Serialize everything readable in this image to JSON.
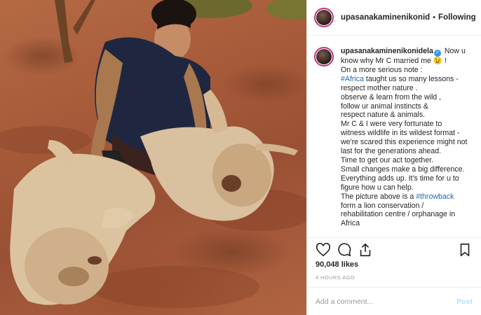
{
  "post": {
    "username": "upasanakaminenikonid",
    "follow_label": "Following",
    "caption_username": "upasanakaminenikonidela",
    "caption_lines": [
      {
        "pre": " Now u",
        "tag": "",
        "post": ""
      },
      {
        "pre": "know why Mr C married me 😉 !",
        "tag": "",
        "post": ""
      },
      {
        "pre": "On a more serious note :",
        "tag": "",
        "post": ""
      },
      {
        "pre": "",
        "tag": "#Africa",
        "post": " taught us so many lessons -"
      },
      {
        "pre": "respect mother nature .",
        "tag": "",
        "post": ""
      },
      {
        "pre": "observe & learn from the wild ,",
        "tag": "",
        "post": ""
      },
      {
        "pre": "follow ur animal instincts &",
        "tag": "",
        "post": ""
      },
      {
        "pre": "respect nature & animals.",
        "tag": "",
        "post": ""
      },
      {
        "pre": "Mr C & I were very fortunate to",
        "tag": "",
        "post": ""
      },
      {
        "pre": "witness wildlife in its wildest format -",
        "tag": "",
        "post": ""
      },
      {
        "pre": "we're scared this experience might not",
        "tag": "",
        "post": ""
      },
      {
        "pre": "last for the generations ahead.",
        "tag": "",
        "post": ""
      },
      {
        "pre": "Time to get our act together.",
        "tag": "",
        "post": ""
      },
      {
        "pre": "Small changes make a big difference.",
        "tag": "",
        "post": ""
      },
      {
        "pre": "Everything adds up. It's time for u to",
        "tag": "",
        "post": ""
      },
      {
        "pre": "figure how u can help.",
        "tag": "",
        "post": ""
      },
      {
        "pre": "The picture above is a ",
        "tag": "#throwback",
        "post": ""
      },
      {
        "pre": "form a lion conservation /",
        "tag": "",
        "post": ""
      },
      {
        "pre": "rehabilitation centre / orphanage in",
        "tag": "",
        "post": ""
      },
      {
        "pre": "Africa",
        "tag": "",
        "post": ""
      }
    ],
    "likes": "90,048 likes",
    "timestamp": "4 HOURS AGO",
    "comment_placeholder": "Add a comment...",
    "post_button": "Post"
  },
  "icons": {
    "like": "heart-icon",
    "comment": "comment-icon",
    "share": "share-icon",
    "save": "bookmark-icon",
    "verified": "verified-badge-icon"
  },
  "colors": {
    "link": "#1f6bb0",
    "verified": "#3897f0",
    "post_button_disabled": "#b2dffc"
  }
}
